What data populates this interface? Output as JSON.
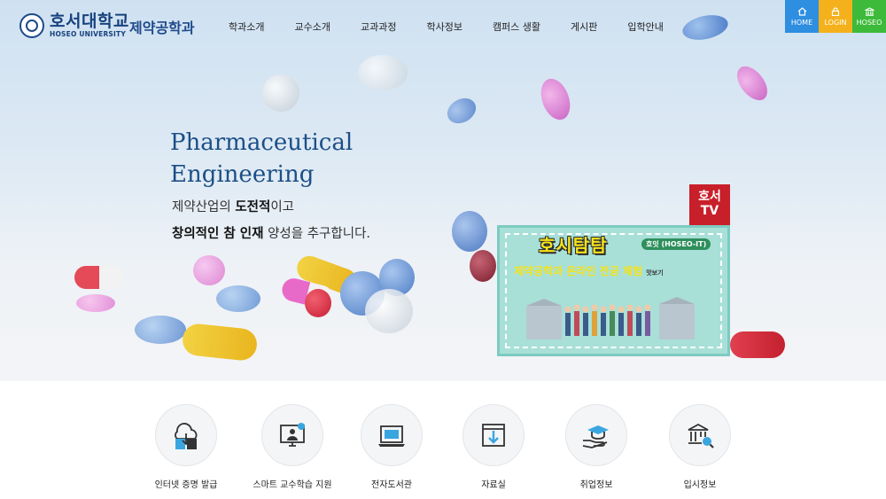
{
  "header": {
    "logo_ko": "호서대학교",
    "logo_en": "HOSEO UNIVERSITY",
    "dept": "제약공학과",
    "nav": [
      "학과소개",
      "교수소개",
      "교과과정",
      "학사정보",
      "캠퍼스 생활",
      "게시판",
      "입학안내"
    ],
    "quick": [
      {
        "label": "HOME",
        "icon": "home-icon",
        "color": "#2e8ee0"
      },
      {
        "label": "LOGIN",
        "icon": "lock-icon",
        "color": "#f5b11b"
      },
      {
        "label": "HOSEO",
        "icon": "building-icon",
        "color": "#3dba3a"
      }
    ]
  },
  "hero": {
    "title_line1": "Pharmaceutical",
    "title_line2": "Engineering",
    "sub1_pre": "제약산업의 ",
    "sub1_bold": "도전적",
    "sub1_post": "이고",
    "sub2_bold": "창의적인 참 인재",
    "sub2_post": " 양성을 추구합니다."
  },
  "banner": {
    "tv_logo_l1": "호서",
    "tv_logo_l2": "TV",
    "title": "호시탐탐",
    "tag": "호잇 (HOSEO-IT)",
    "subtitle": "제약공학과 온라인 전공 체험",
    "subtitle_small": "맛보기"
  },
  "quick_menu": [
    {
      "label": "인터넷 증명 발급",
      "icon": "certificate-icon"
    },
    {
      "label": "스마트 교수학습 지원",
      "icon": "online-learning-icon"
    },
    {
      "label": "전자도서관",
      "icon": "e-library-icon"
    },
    {
      "label": "자료실",
      "icon": "download-icon"
    },
    {
      "label": "취업정보",
      "icon": "graduation-cap-icon"
    },
    {
      "label": "입시정보",
      "icon": "admission-search-icon"
    }
  ],
  "colors": {
    "brand": "#17427e",
    "accent_blue": "#2e8ee0",
    "accent_yellow": "#f5b11b",
    "accent_green": "#3dba3a"
  }
}
